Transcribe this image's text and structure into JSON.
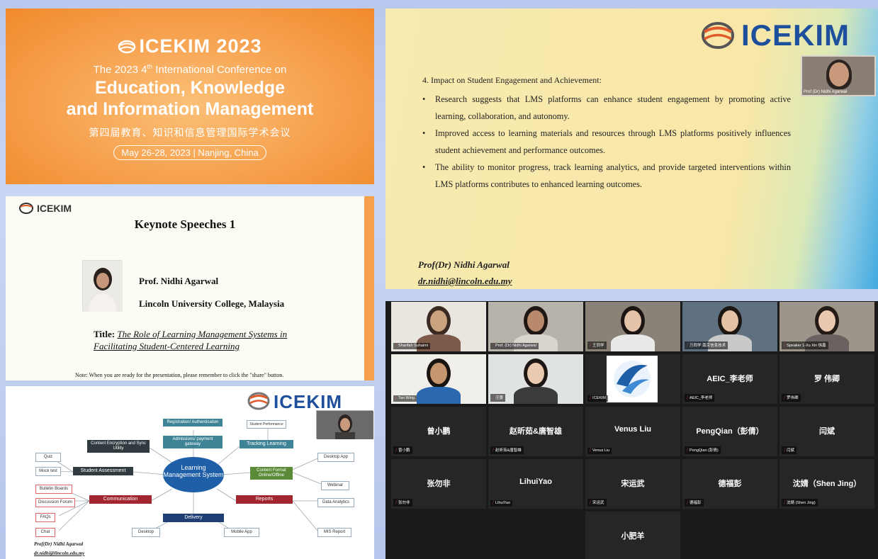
{
  "banner": {
    "brand": "ICEKIM 2023",
    "subtitle_pre": "The 2023 4",
    "subtitle_sup": "th",
    "subtitle_post": " International Conference on",
    "line1": "Education, Knowledge",
    "line2": "and Information Management",
    "chinese": "第四届教育、知识和信息管理国际学术会议",
    "date": "May 26-28, 2023 | Nanjing, China"
  },
  "keynote": {
    "logo": "ICEKIM",
    "title": "Keynote Speeches 1",
    "speaker": "Prof. Nidhi Agarwal",
    "affiliation": "Lincoln University College, Malaysia",
    "talk_label": "Title: ",
    "talk_title": "The Role of Learning Management Systems in Facilitating Student-Centered Learning",
    "note": "Note: When you are ready for the presentation, please remember to click the \"share\" button."
  },
  "mindmap": {
    "logo": "ICEKIM",
    "center": "Learning Management System",
    "nodes": {
      "registration": "Registration/ Authentication",
      "admission": "Admissions/ payment gateway",
      "tracking": "Tracking Learning",
      "student_perf": "Student Performance",
      "encryption": "Content Encryption and Sync Utility",
      "assessment": "Student Assessment",
      "content_format": "Content Format Online/Offline",
      "communication": "Communication",
      "reports": "Reports",
      "delivery": "Delivery",
      "desktop": "Desktop",
      "mobile": "Mobile App",
      "desktop_app": "Desktop App",
      "webinar": "Webinar",
      "data_analytics": "Data Analytics",
      "msc_report": "MIS Report",
      "quiz": "Quiz",
      "mock_test": "Mock test",
      "bulletin": "Bulletin Boards",
      "discussion": "Discussion Forum",
      "faqs": "FAQs",
      "chat": "Chat"
    },
    "signature_name": "Prof(Dr) Nidhi Agarwal",
    "signature_email": "dr.nidhi@lincoln.edu.my"
  },
  "engagement": {
    "logo": "ICEKIM",
    "cam_label": "Prof (Dr) Nidhi Agarwal",
    "heading": "4. Impact on Student Engagement and Achievement:",
    "bullets": [
      "Research suggests that LMS platforms can enhance student engagement by promoting active learning, collaboration, and autonomy.",
      "Improved access to learning materials and resources through LMS platforms positively influences student achievement and performance outcomes.",
      "The ability to monitor progress, track learning analytics, and provide targeted interventions within LMS platforms contributes to enhanced learning outcomes."
    ],
    "presenter": "Prof(Dr) Nidhi Agarwal",
    "email": "dr.nidhi@lincoln.edu.my"
  },
  "gallery": {
    "tiles": [
      {
        "name": "",
        "label": "Sharifah Suhaimi",
        "video": true
      },
      {
        "name": "",
        "label": "Prof. (Dr) Nidhi Agarwal",
        "video": true
      },
      {
        "name": "",
        "label": "王同学",
        "video": true
      },
      {
        "name": "",
        "label": "万同学 南京信息技术",
        "video": true
      },
      {
        "name": "",
        "label": "Speaker 1-Xu Xin 徐鑫",
        "video": true
      },
      {
        "name": "",
        "label": "Tan Wing",
        "video": true
      },
      {
        "name": "",
        "label": "汪蕾",
        "video": true
      },
      {
        "name": "",
        "label": "ICEKIM",
        "video": true
      },
      {
        "name": "AEIC_李老师",
        "label": "AEIC_李老师",
        "video": false
      },
      {
        "name": "罗 伟卿",
        "label": "罗伟卿",
        "video": false
      },
      {
        "name": "曾小鹏",
        "label": "曾小鹏",
        "video": false
      },
      {
        "name": "赵昕茹&唐智雄",
        "label": "赵昕茹&唐智雄",
        "video": false
      },
      {
        "name": "Venus Liu",
        "label": "Venus Liu",
        "video": false
      },
      {
        "name": "PengQian（彭倩）",
        "label": "PengQian (彭倩)",
        "video": false
      },
      {
        "name": "闫斌",
        "label": "闫斌",
        "video": false
      },
      {
        "name": "张勿非",
        "label": "张勿非",
        "video": false
      },
      {
        "name": "LihuiYao",
        "label": "LihuiYao",
        "video": false
      },
      {
        "name": "宋运武",
        "label": "宋运武",
        "video": false
      },
      {
        "name": "德福彭",
        "label": "德福彭",
        "video": false
      },
      {
        "name": "沈婧（Shen Jing）",
        "label": "沈婧 (Shen Jing)",
        "video": false
      },
      {
        "name": "小肥羊",
        "label": "",
        "video": false
      }
    ],
    "colors": {
      "active_border": "#8bcf2b",
      "mic_muted": "#e34b4b"
    }
  }
}
